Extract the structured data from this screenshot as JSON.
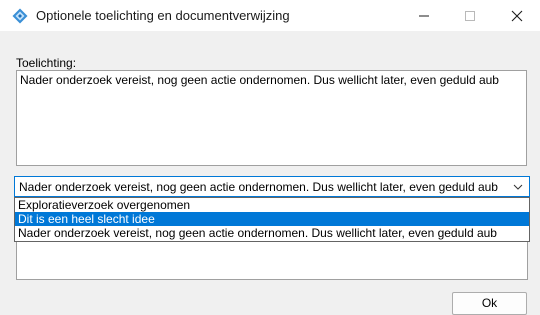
{
  "window": {
    "title": "Optionele toelichting en documentverwijzing",
    "controls": {
      "minimize": "minimize-icon",
      "maximize": "maximize-icon",
      "close": "close-icon"
    }
  },
  "form": {
    "toelichting_label": "Toelichting:",
    "toelichting_value": "Nader onderzoek vereist, nog geen actie ondernomen. Dus wellicht later, even geduld aub",
    "combo_value": "Nader onderzoek vereist, nog geen actie ondernomen. Dus wellicht later, even geduld aub",
    "options": [
      "Exploratieverzoek overgenomen",
      "Dit is een heel slecht idee",
      "Nader onderzoek vereist, nog geen actie ondernomen. Dus wellicht later, even geduld aub"
    ],
    "highlighted_option_index": 1
  },
  "buttons": {
    "ok_label": "Ok"
  },
  "colors": {
    "accent": "#0078d7",
    "background": "#f0f0f0"
  }
}
